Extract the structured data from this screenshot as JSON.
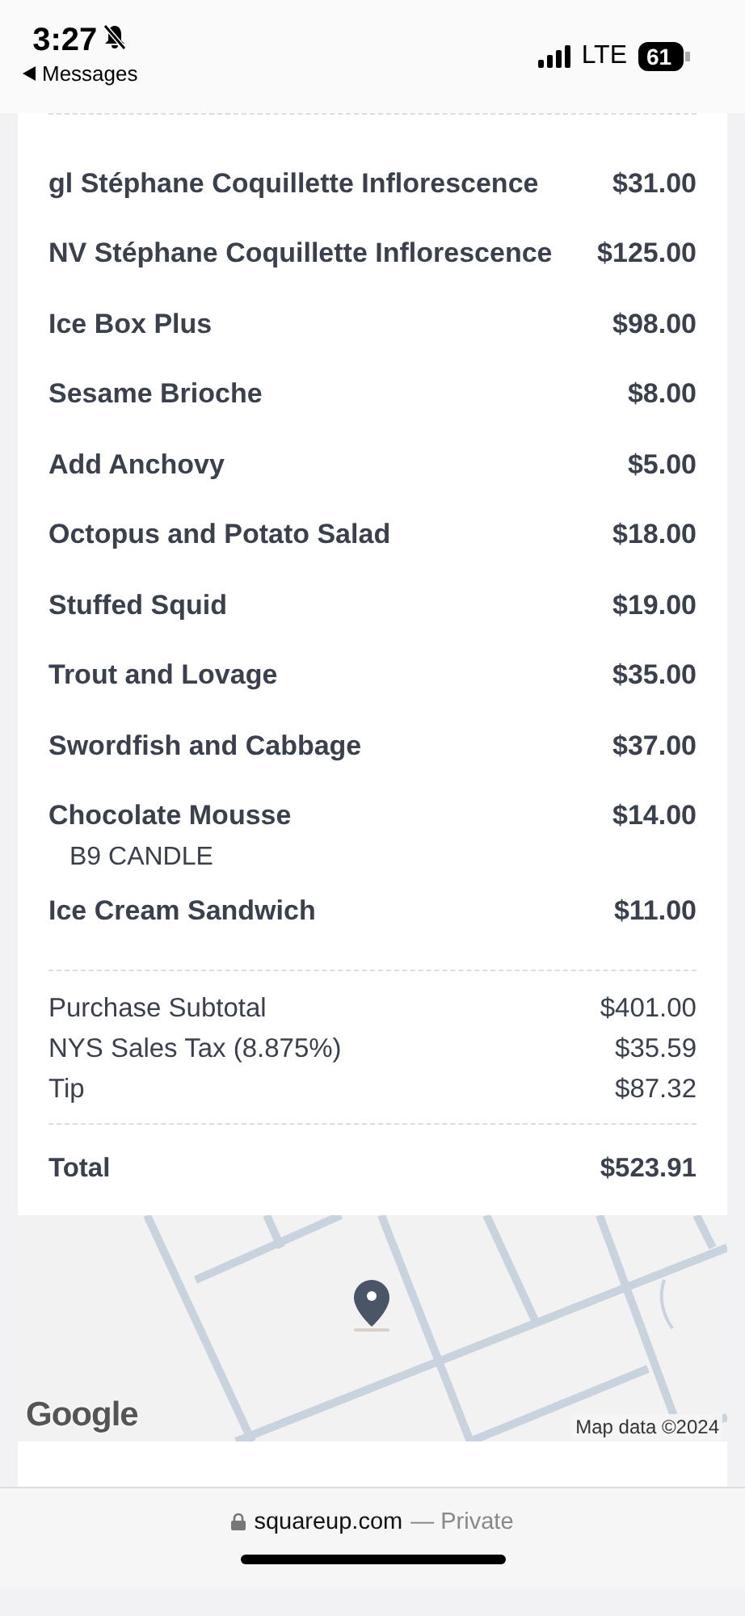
{
  "status_bar": {
    "time": "3:27",
    "back_label": "Messages",
    "network": "LTE",
    "battery": "61",
    "silent": true
  },
  "items": [
    {
      "name": "gl Stéphane Coquillette Inflorescence",
      "price": "$31.00"
    },
    {
      "name": "NV Stéphane Coquillette Inflorescence",
      "price": "$125.00"
    },
    {
      "name": "Ice Box Plus",
      "price": "$98.00"
    },
    {
      "name": "Sesame Brioche",
      "price": "$8.00"
    },
    {
      "name": "Add Anchovy",
      "price": "$5.00"
    },
    {
      "name": "Octopus and Potato Salad",
      "price": "$18.00"
    },
    {
      "name": "Stuffed Squid",
      "price": "$19.00"
    },
    {
      "name": "Trout and Lovage",
      "price": "$35.00"
    },
    {
      "name": "Swordfish and Cabbage",
      "price": "$37.00"
    },
    {
      "name": "Chocolate Mousse",
      "price": "$14.00",
      "modifiers": [
        "B9 CANDLE"
      ]
    },
    {
      "name": "Ice Cream Sandwich",
      "price": "$11.00"
    }
  ],
  "summary": [
    {
      "label": "Purchase Subtotal",
      "amount": "$401.00"
    },
    {
      "label": "NYS Sales Tax (8.875%)",
      "amount": "$35.59"
    },
    {
      "label": "Tip",
      "amount": "$87.32"
    }
  ],
  "total": {
    "label": "Total",
    "amount": "$523.91"
  },
  "map": {
    "kind": "picture",
    "logo": "Google",
    "attribution": "Map data ©2024"
  },
  "address_bar": {
    "domain": "squareup.com",
    "suffix": "— Private"
  }
}
